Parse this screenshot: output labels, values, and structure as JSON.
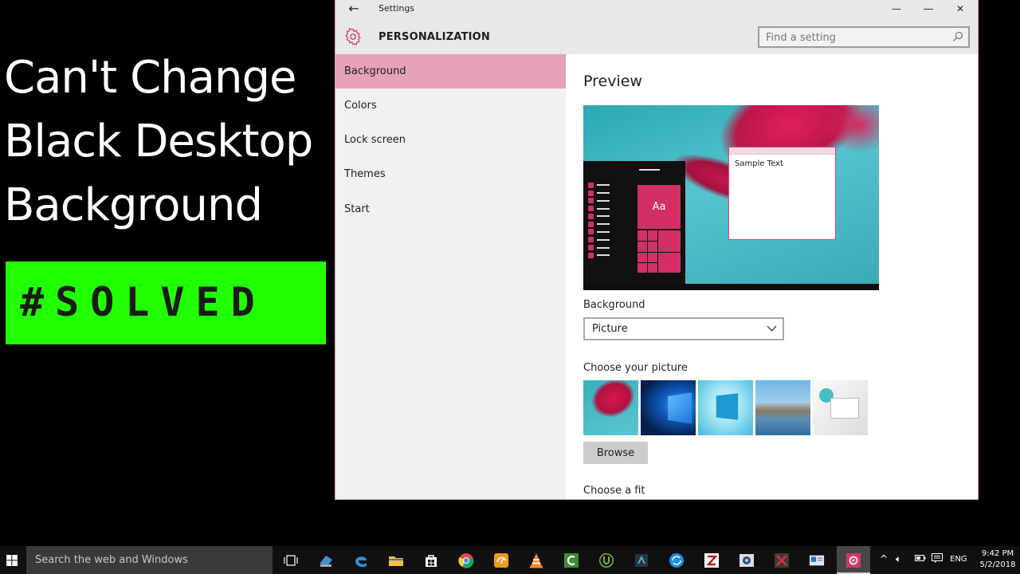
{
  "overlay": {
    "headline_lines": [
      "Can't Change",
      "Black Desktop",
      "Background"
    ],
    "badge": "#SOLVED"
  },
  "window": {
    "title": "Settings",
    "section": "PERSONALIZATION",
    "search_placeholder": "Find a setting",
    "controls": {
      "minimize": "—",
      "maximize": "☐",
      "close": "✕"
    }
  },
  "sidebar": {
    "items": [
      {
        "label": "Background",
        "active": true
      },
      {
        "label": "Colors"
      },
      {
        "label": "Lock screen"
      },
      {
        "label": "Themes"
      },
      {
        "label": "Start"
      }
    ]
  },
  "content": {
    "preview_title": "Preview",
    "preview_sample_text": "Sample Text",
    "preview_tile_text": "Aa",
    "background_label": "Background",
    "background_value": "Picture",
    "choose_picture_label": "Choose your picture",
    "browse_label": "Browse",
    "choose_fit_label": "Choose a fit"
  },
  "taskbar": {
    "search_placeholder": "Search the web and Windows",
    "language": "ENG",
    "time": "9:42 PM",
    "date": "5/2/2018"
  },
  "colors": {
    "accent": "#e6a2b7",
    "badge_green": "#22ff00",
    "tile_pink": "#d32f65"
  }
}
